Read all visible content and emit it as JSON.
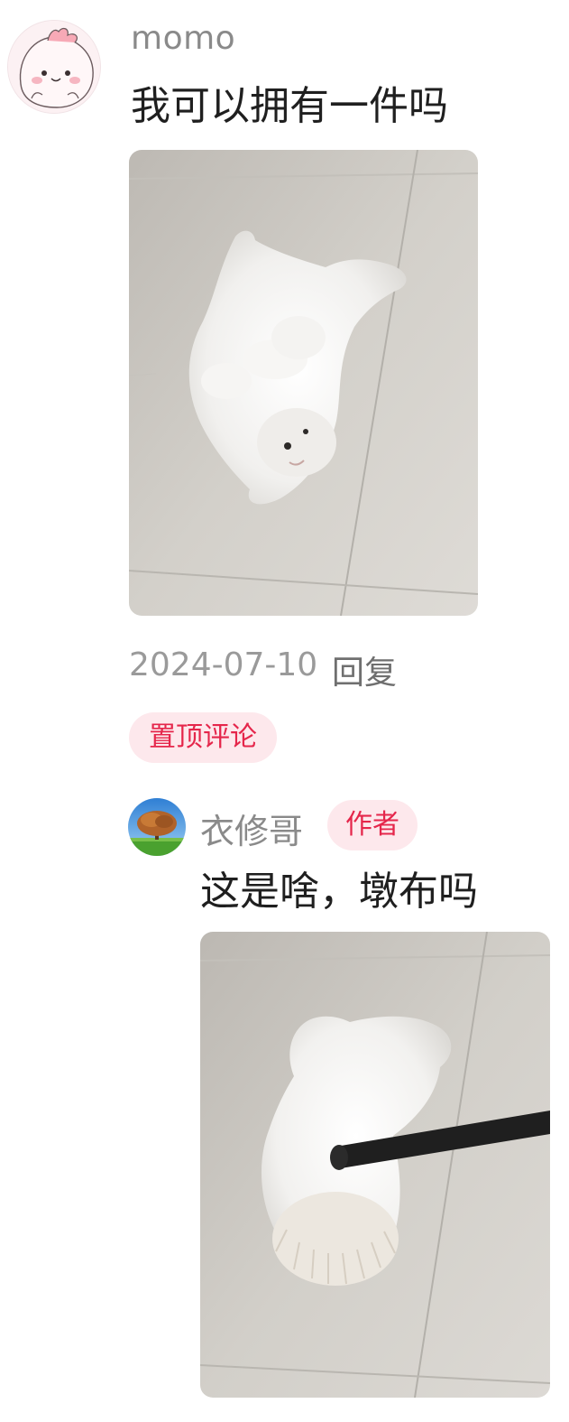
{
  "comment": {
    "username": "momo",
    "text": "我可以拥有一件吗",
    "photo_subject": "white fluffy cat lying on its back on tiled floor",
    "date": "2024-07-10",
    "reply_label": "回复",
    "pinned_label": "置顶评论"
  },
  "reply": {
    "username": "衣修哥",
    "author_badge": "作者",
    "text": "这是啥，墩布吗",
    "photo_subject": "white fluffy mop with black handle on tiled floor"
  },
  "colors": {
    "accent_red": "#e5264b",
    "tag_background": "#fde8ec",
    "muted_text": "#8a8a8a"
  }
}
